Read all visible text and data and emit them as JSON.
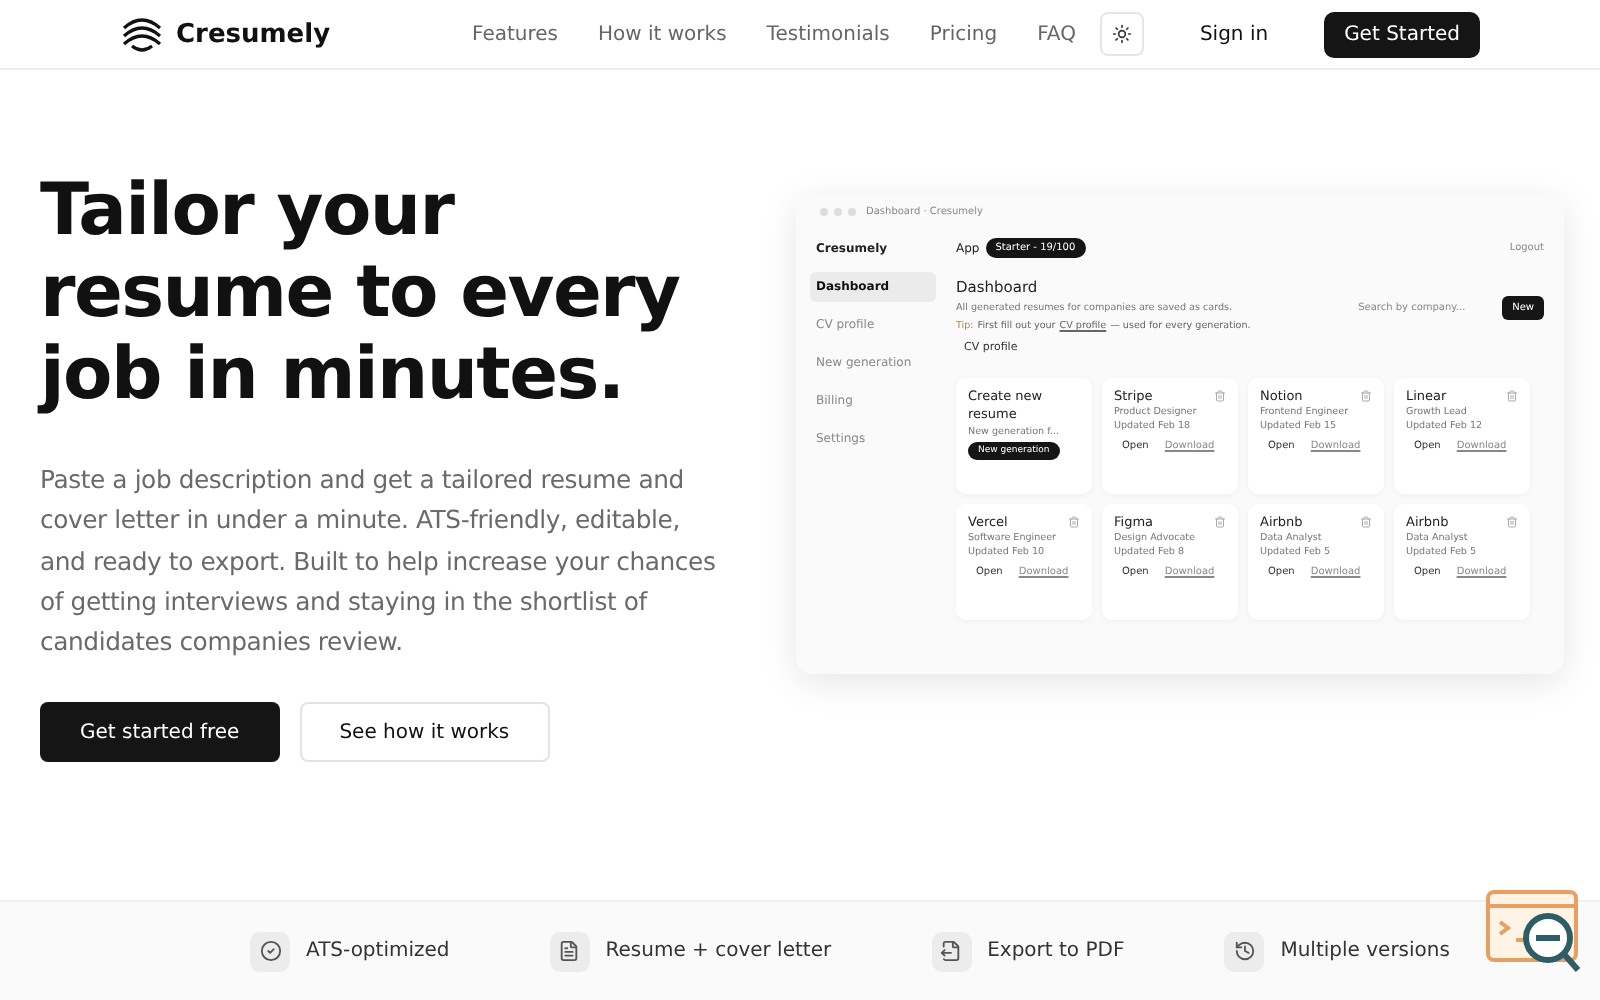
{
  "header": {
    "brand": "Cresumely",
    "nav": [
      "Features",
      "How it works",
      "Testimonials",
      "Pricing",
      "FAQ"
    ],
    "sign_in": "Sign in",
    "cta": "Get Started"
  },
  "hero": {
    "title": "Tailor your resume to every job in minutes.",
    "description": "Paste a job description and get a tailored resume and cover letter in under a minute. ATS-friendly, editable, and ready to export. Built to help increase your chances of getting interviews and staying in the shortlist of candidates companies review.",
    "primary_button": "Get started free",
    "secondary_button": "See how it works"
  },
  "mockup": {
    "window_title": "Dashboard · Cresumely",
    "brand": "Cresumely",
    "app_label": "App",
    "plan_badge": "Starter - 19/100",
    "logout": "Logout",
    "sidebar": [
      {
        "label": "Dashboard",
        "selected": true
      },
      {
        "label": "CV profile",
        "selected": false
      },
      {
        "label": "New generation",
        "selected": false
      },
      {
        "label": "Billing",
        "selected": false
      },
      {
        "label": "Settings",
        "selected": false
      }
    ],
    "heading": "Dashboard",
    "subtitle": "All generated resumes for companies are saved as cards.",
    "search_placeholder": "Search by company...",
    "new_button": "New",
    "tip_label": "Tip:",
    "tip_before": "First fill out your",
    "tip_link": "CV profile",
    "tip_after": "— used for every generation.",
    "section_button": "CV profile",
    "cards": [
      {
        "kind": "create",
        "title": "Create new resume",
        "subtitle": "New generation f...",
        "button": "New generation"
      },
      {
        "kind": "resume",
        "title": "Stripe",
        "role": "Product Designer",
        "updated": "Updated Feb 18",
        "open": "Open",
        "download": "Download"
      },
      {
        "kind": "resume",
        "title": "Notion",
        "role": "Frontend Engineer",
        "updated": "Updated Feb 15",
        "open": "Open",
        "download": "Download"
      },
      {
        "kind": "resume",
        "title": "Linear",
        "role": "Growth Lead",
        "updated": "Updated Feb 12",
        "open": "Open",
        "download": "Download"
      },
      {
        "kind": "resume",
        "title": "Vercel",
        "role": "Software Engineer",
        "updated": "Updated Feb 10",
        "open": "Open",
        "download": "Download"
      },
      {
        "kind": "resume",
        "title": "Figma",
        "role": "Design Advocate",
        "updated": "Updated Feb 8",
        "open": "Open",
        "download": "Download"
      },
      {
        "kind": "resume",
        "title": "Airbnb",
        "role": "Data Analyst",
        "updated": "Updated Feb 5",
        "open": "Open",
        "download": "Download"
      },
      {
        "kind": "resume",
        "title": "Airbnb",
        "role": "Data Analyst",
        "updated": "Updated Feb 5",
        "open": "Open",
        "download": "Download"
      }
    ]
  },
  "features": [
    {
      "kind": "check",
      "label": "ATS-optimized"
    },
    {
      "kind": "document",
      "label": "Resume + cover letter"
    },
    {
      "kind": "export",
      "label": "Export to PDF"
    },
    {
      "kind": "history",
      "label": "Multiple versions"
    }
  ]
}
